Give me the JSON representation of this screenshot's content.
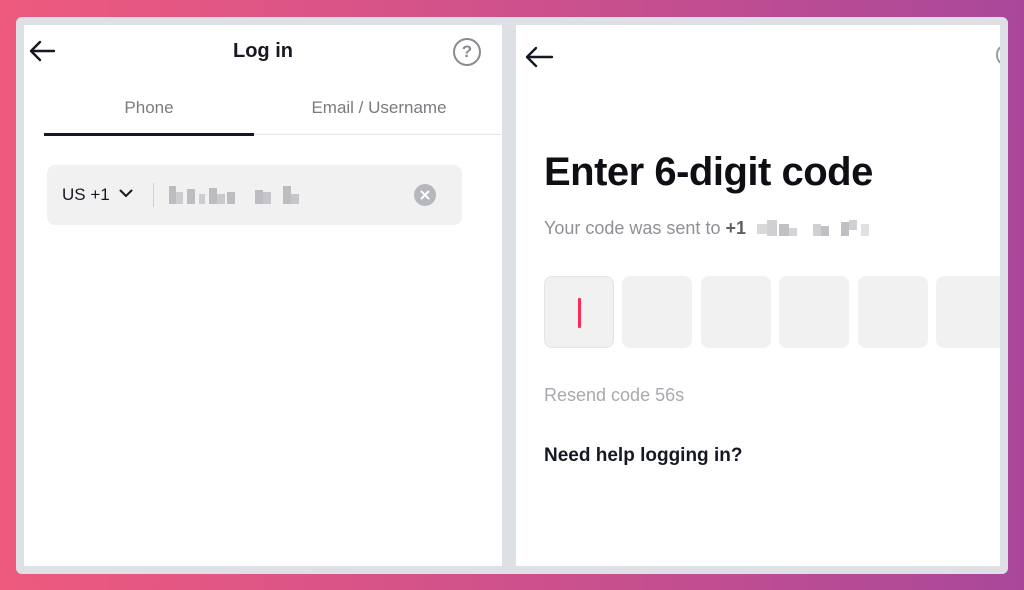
{
  "login": {
    "title": "Log in",
    "tabs": [
      {
        "label": "Phone",
        "selected": true
      },
      {
        "label": "Email / Username",
        "selected": false
      }
    ],
    "phone_field": {
      "country_code": "US +1",
      "value_masked": true
    },
    "help_glyph": "?"
  },
  "verify": {
    "title": "Enter 6-digit code",
    "sent_text": "Your code was sent to",
    "sent_prefix": "+1",
    "digit_count": 6,
    "resend_text": "Resend code 56s",
    "help_link": "Need help logging in?"
  },
  "colors": {
    "accent": "#fe2c55",
    "text_primary": "#161823",
    "muted": "#8f9096",
    "field_bg": "#f1f1f2"
  },
  "icons": [
    "back-arrow-icon",
    "help-circle-icon",
    "chevron-down-icon",
    "clear-icon"
  ]
}
